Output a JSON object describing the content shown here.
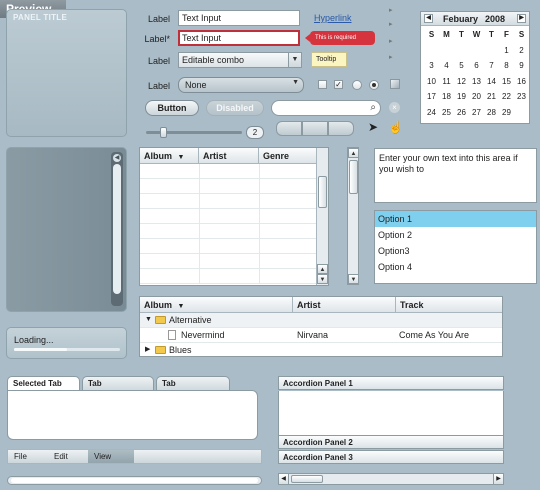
{
  "header": {
    "title": "Preview"
  },
  "panel": {
    "title": "PANEL TITLE"
  },
  "loading": {
    "text": "Loading...",
    "progress": 0.5
  },
  "form": {
    "label1": "Label",
    "label2": "Label*",
    "label3": "Label",
    "label4": "Label",
    "input1": "Text Input",
    "input2": "Text Input",
    "combo": "Editable combo",
    "dropdown": "None",
    "hyperlink": "Hyperlink",
    "error_tip": "This is required",
    "tooltip": "Tooltip",
    "button": "Button",
    "disabled_button": "Disabled",
    "spinner_value": "2"
  },
  "calendar": {
    "month": "Febuary",
    "year": "2008",
    "days_of_week": [
      "S",
      "M",
      "T",
      "W",
      "T",
      "F",
      "S"
    ],
    "days": [
      "",
      "",
      "",
      "",
      "",
      "1",
      "2",
      "3",
      "4",
      "5",
      "6",
      "7",
      "8",
      "9",
      "10",
      "11",
      "12",
      "13",
      "14",
      "15",
      "16",
      "17",
      "18",
      "19",
      "20",
      "21",
      "22",
      "23",
      "24",
      "25",
      "26",
      "27",
      "28",
      "29",
      ""
    ]
  },
  "grid": {
    "columns": [
      "Album",
      "Artist",
      "Genre"
    ],
    "sort_indicator": "▼"
  },
  "textarea": {
    "text": "Enter your own text into this area if you wish to"
  },
  "listbox": {
    "items": [
      "Option 1",
      "Option 2",
      "Option3",
      "Option 4"
    ],
    "selected_index": 0
  },
  "tree": {
    "columns": [
      "Album",
      "Artist",
      "Track"
    ],
    "sort_indicator": "▼",
    "rows": [
      {
        "label": "Alternative",
        "artist": "",
        "track": ""
      },
      {
        "label": "Nevermind",
        "artist": "Nirvana",
        "track": "Come As You Are"
      },
      {
        "label": "Blues",
        "artist": "",
        "track": ""
      }
    ]
  },
  "tabs": [
    {
      "label": "Selected Tab",
      "selected": true
    },
    {
      "label": "Tab",
      "selected": false
    },
    {
      "label": "Tab",
      "selected": false
    }
  ],
  "menu": [
    {
      "label": "File",
      "active": false
    },
    {
      "label": "Edit",
      "active": false
    },
    {
      "label": "View",
      "active": true
    }
  ],
  "accordion": [
    {
      "label": "Accordion Panel 1"
    },
    {
      "label": "Accordion Panel 2"
    },
    {
      "label": "Accordion Panel 3"
    }
  ],
  "colors": {
    "background": "#a9bcc8",
    "error": "#d5343e",
    "selection": "#7fd0ee",
    "link": "#2a5aa8"
  }
}
